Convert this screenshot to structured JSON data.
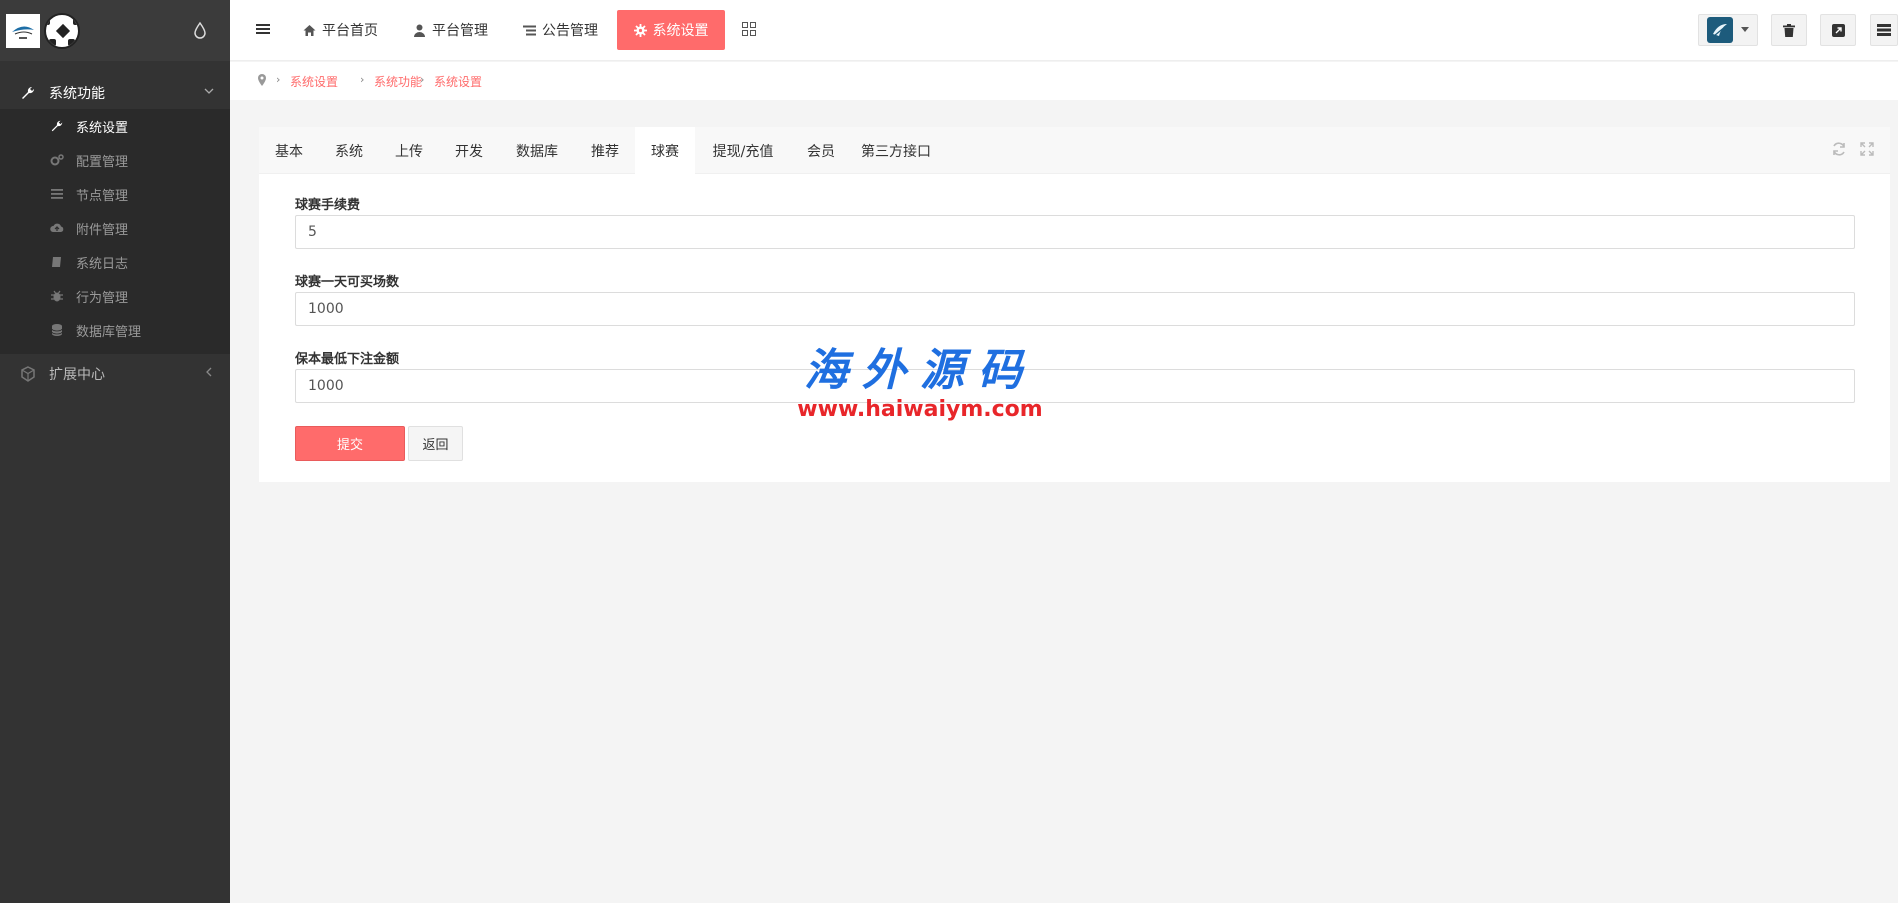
{
  "sidebar": {
    "groups": [
      {
        "label": "系统功能",
        "icon": "wrench-icon"
      },
      {
        "label": "扩展中心",
        "icon": "cubes-icon"
      }
    ],
    "items": [
      {
        "label": "系统设置",
        "icon": "wrench-icon",
        "active": true
      },
      {
        "label": "配置管理",
        "icon": "gears-icon"
      },
      {
        "label": "节点管理",
        "icon": "bars-icon"
      },
      {
        "label": "附件管理",
        "icon": "cloud-upload-icon"
      },
      {
        "label": "系统日志",
        "icon": "book-icon"
      },
      {
        "label": "行为管理",
        "icon": "bug-icon"
      },
      {
        "label": "数据库管理",
        "icon": "database-icon"
      }
    ]
  },
  "topnav": {
    "items": [
      {
        "label": "平台首页",
        "icon": "home-icon"
      },
      {
        "label": "平台管理",
        "icon": "user-icon"
      },
      {
        "label": "公告管理",
        "icon": "list-icon"
      },
      {
        "label": "系统设置",
        "icon": "gear-icon",
        "active": true
      }
    ]
  },
  "breadcrumb": [
    "系统设置",
    "系统功能",
    "系统设置"
  ],
  "tabs": [
    "基本",
    "系统",
    "上传",
    "开发",
    "数据库",
    "推荐",
    "球赛",
    "提现/充值",
    "会员",
    "第三方接口"
  ],
  "active_tab": "球赛",
  "form": {
    "fields": [
      {
        "label": "球赛手续费",
        "value": "5"
      },
      {
        "label": "球赛一天可买场数",
        "value": "1000"
      },
      {
        "label": "保本最低下注金额",
        "value": "1000"
      }
    ],
    "submit_label": "提交",
    "back_label": "返回"
  },
  "watermark": {
    "title": "海外源码",
    "url": "www.haiwaiym.com"
  },
  "colors": {
    "accent": "#ff6b6b",
    "sidebar_bg": "#333333",
    "submenu_bg": "#2a2a2a"
  }
}
